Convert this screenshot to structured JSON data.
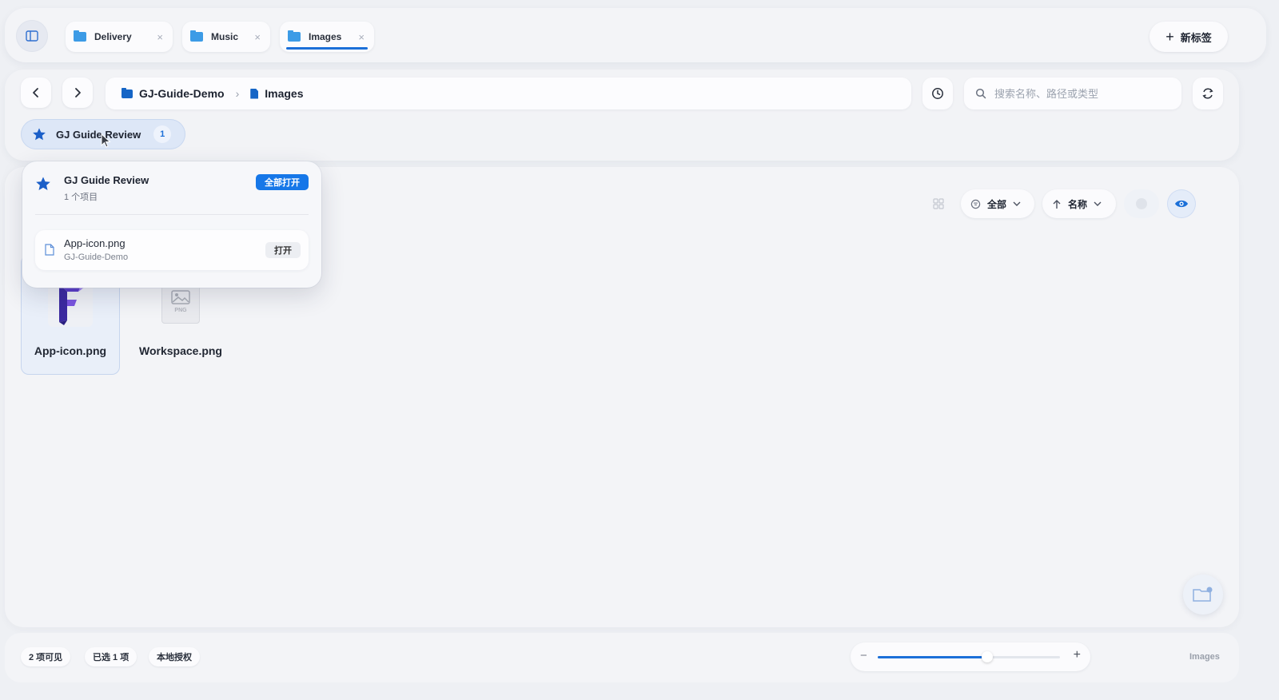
{
  "tabs": [
    {
      "label": "Delivery",
      "close": "×"
    },
    {
      "label": "Music",
      "close": "×"
    },
    {
      "label": "Images",
      "close": "×",
      "active": true
    }
  ],
  "new_tab_label": "新标签",
  "breadcrumb": {
    "root": "GJ-Guide-Demo",
    "current": "Images"
  },
  "search": {
    "placeholder": "搜索名称、路径或类型",
    "value": ""
  },
  "favorite_chip": {
    "label": "GJ Guide Review",
    "count": "1"
  },
  "popover": {
    "title": "GJ Guide Review",
    "subtitle": "1 个项目",
    "open_all": "全部打开",
    "items": [
      {
        "name": "App-icon.png",
        "path": "GJ-Guide-Demo",
        "open": "打开"
      }
    ]
  },
  "view_tools": {
    "filter": "全部",
    "sort": "名称"
  },
  "files": [
    {
      "name": "App-icon.png",
      "selected": true
    },
    {
      "name": "Workspace.png",
      "thumb_tag": "PNG",
      "selected": false
    }
  ],
  "status": {
    "visible": "2 项可见",
    "selected": "已选 1 项",
    "license": "本地授权",
    "location": "Images",
    "zoom_fraction": 0.6
  },
  "colors": {
    "accent": "#1b6fd8",
    "folder": "#3c9be6",
    "open_all_bg": "#1677e8"
  }
}
